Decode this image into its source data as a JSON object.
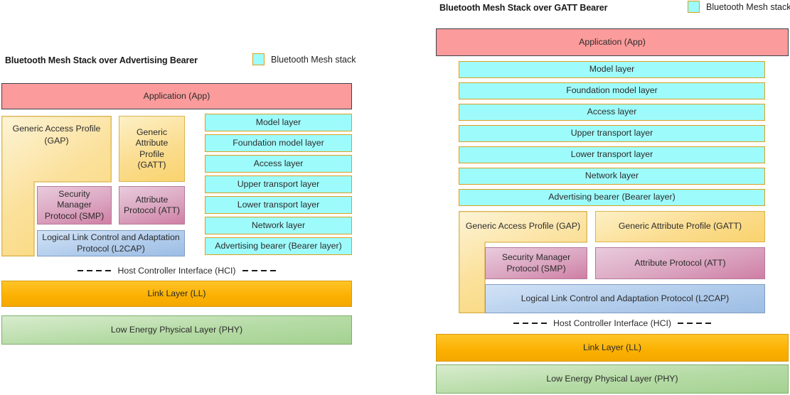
{
  "legend": {
    "swatch_color": "#9efbfb",
    "swatch_border": "#d9a021",
    "label": "Bluetooth Mesh stack"
  },
  "hci": {
    "label": "Host Controller Interface (HCI)"
  },
  "left_diagram": {
    "title": "Bluetooth Mesh Stack over Advertising Bearer",
    "application": "Application (App)",
    "mesh_layers": [
      "Model layer",
      "Foundation model layer",
      "Access layer",
      "Upper transport layer",
      "Lower transport layer",
      "Network layer",
      "Advertising bearer (Bearer layer)"
    ],
    "gap": "Generic Access Profile\n(GAP)",
    "gap_line1": "Generic Access Profile",
    "gap_line2": "(GAP)",
    "gatt_line1": "Generic",
    "gatt_line2": "Attribute Profile",
    "gatt_line3": "(GATT)",
    "smp_line1": "Security Manager",
    "smp_line2": "Protocol (SMP)",
    "att_line1": "Attribute",
    "att_line2": "Protocol (ATT)",
    "l2cap_line1": "Logical Link Control and Adaptation",
    "l2cap_line2": "Protocol (L2CAP)",
    "link_layer": "Link Layer (LL)",
    "phy": "Low Energy Physical Layer (PHY)"
  },
  "right_diagram": {
    "title": "Bluetooth Mesh Stack over GATT Bearer",
    "application": "Application (App)",
    "mesh_layers": [
      "Model layer",
      "Foundation model layer",
      "Access layer",
      "Upper transport layer",
      "Lower transport layer",
      "Network layer",
      "Advertising bearer (Bearer layer)"
    ],
    "gap": "Generic Access Profile (GAP)",
    "gatt": "Generic Attribute Profile (GATT)",
    "smp_line1": "Security Manager",
    "smp_line2": "Protocol (SMP)",
    "att": "Attribute Protocol (ATT)",
    "l2cap": "Logical Link Control and Adaptation Protocol (L2CAP)",
    "link_layer": "Link Layer (LL)",
    "phy": "Low Energy Physical Layer (PHY)"
  }
}
